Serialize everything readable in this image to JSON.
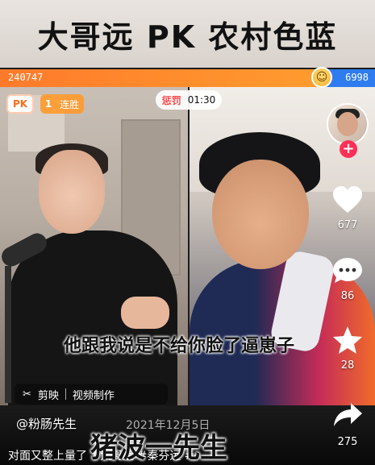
{
  "title_banner": {
    "text": "大哥远 PK 农村色蓝"
  },
  "pk_bar": {
    "left_score": "240747",
    "right_score": "6998",
    "center_icon": "emoji-face-icon"
  },
  "stream_left": {
    "pk_badge": "PK",
    "streak_number": "1",
    "streak_label": "连胜"
  },
  "timer": {
    "label": "惩罚",
    "time": "01:30"
  },
  "right_rail": {
    "like_count": "677",
    "comment_count": "86",
    "favorite_count": "28",
    "share_count": "275"
  },
  "subtitle": "他跟我说是不给你脸了逼崽子",
  "watermark": {
    "app": "剪映",
    "label": "视频制作"
  },
  "post": {
    "author": "@粉肠先生",
    "date": "2021年12月5日",
    "description": "对面又整上量了 #大哥远 #秦芬远 #",
    "big_caption": "猪波一先生"
  },
  "colors": {
    "left_team": "#ff8a2b",
    "right_team": "#2f7cf0",
    "follow": "#ff2f55"
  }
}
